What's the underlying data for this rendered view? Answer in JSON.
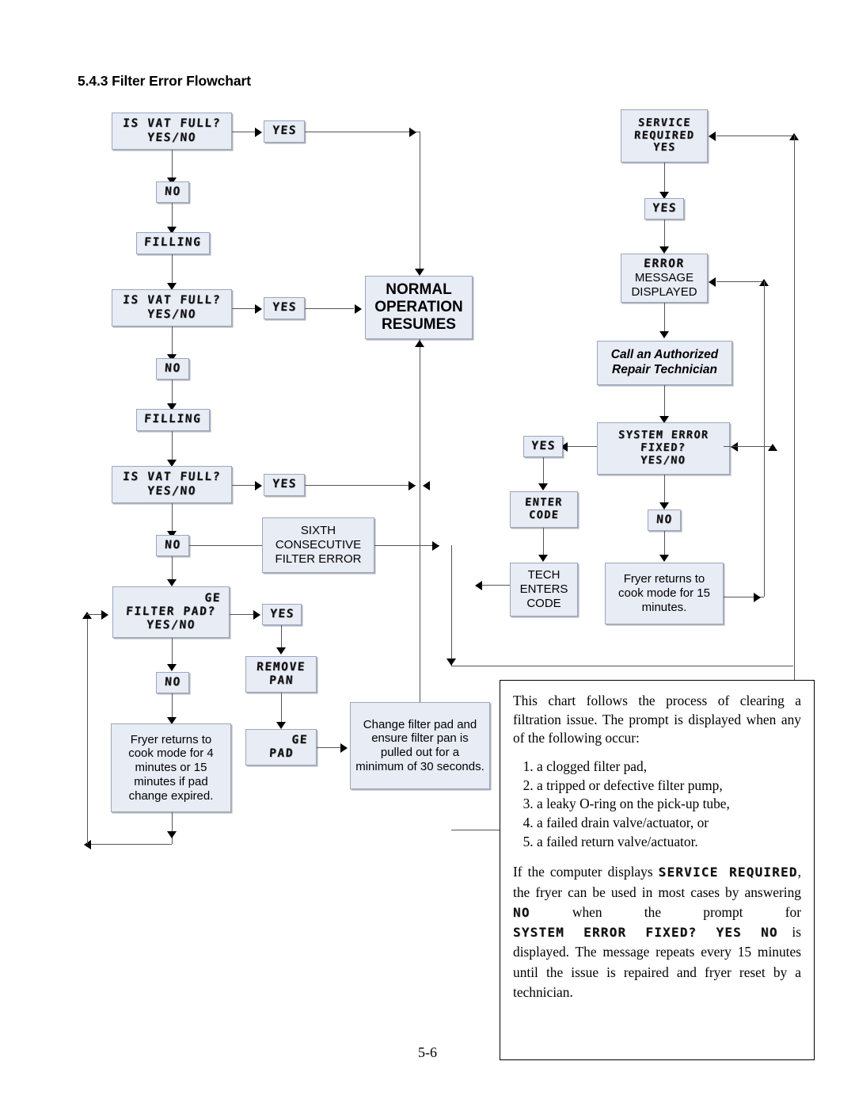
{
  "heading": "5.4.3 Filter Error Flowchart",
  "folio": "5-6",
  "left_column": {
    "vat_full_1": {
      "line1": "IS VAT FULL?",
      "line2": "YES/NO"
    },
    "yes_1": "YES",
    "no_1": "NO",
    "filling_1": "FILLING",
    "vat_full_2": {
      "line1": "IS VAT FULL?",
      "line2": "YES/NO"
    },
    "yes_2": "YES",
    "no_2": "NO",
    "filling_2": "FILLING",
    "vat_full_3": {
      "line1": "IS VAT FULL?",
      "line2": "YES/NO"
    },
    "yes_3": "YES",
    "no_3": "NO",
    "sixth_error": {
      "line1": "SIXTH",
      "line2": "CONSECUTIVE",
      "line3": "FILTER ERROR"
    },
    "change_pad_prompt": {
      "line1": "GE",
      "line2": "FILTER PAD?",
      "line3": "YES/NO"
    },
    "yes_4": "YES",
    "no_4": "NO",
    "remove_pan": {
      "line1": "REMOVE",
      "line2": "PAN"
    },
    "change_pad": {
      "line1": "GE",
      "line2": "PAD"
    },
    "fryer_returns_4": "Fryer returns to cook mode for 4 minutes or 15 minutes if pad change expired.",
    "change_filter_pad_note": "Change filter pad and ensure filter pan is pulled out for a minimum of 30 seconds."
  },
  "center": {
    "normal_operation": {
      "line1": "NORMAL",
      "line2": "OPERATION",
      "line3": "RESUMES"
    }
  },
  "right_column": {
    "service_required": {
      "line1": "SERVICE",
      "line2": "REQUIRED",
      "line3": "YES"
    },
    "yes_top": "YES",
    "error_message": {
      "lcd": "ERROR",
      "line2": "MESSAGE",
      "line3": "DISPLAYED"
    },
    "call_technician": {
      "line1": "Call an Authorized",
      "line2": "Repair Technician"
    },
    "system_error": {
      "line1": "SYSTEM ERROR",
      "line2": "FIXED?",
      "line3": "YES/NO"
    },
    "yes_sys": "YES",
    "no_sys": "NO",
    "enter_code": {
      "line1": "ENTER",
      "line2": "CODE"
    },
    "tech_enters_code": {
      "line1": "TECH",
      "line2": "ENTERS",
      "line3": "CODE"
    },
    "fryer_returns_15": "Fryer returns to cook mode for 15 minutes."
  },
  "note": {
    "intro": "This chart follows the process of clearing a filtration issue. The prompt is displayed when any of the following occur:",
    "causes": [
      "a clogged filter pad,",
      "a tripped or defective filter pump,",
      "a leaky O-ring on the pick-up tube,",
      "a failed drain valve/actuator, or",
      "a failed return valve/actuator."
    ],
    "para2": {
      "t1": "If the computer displays ",
      "lcd1": "SERVICE REQUIRED",
      "t2": ", the fryer can be used in most cases by answering ",
      "lcd2": "NO",
      "t3": " when the prompt for ",
      "lcd3": "SYSTEM ERROR FIXED? YES NO",
      "t4": " is displayed. The message repeats every 15 minutes until the issue is repaired and fryer reset by a technician."
    }
  },
  "colors": {
    "box_fill": "#e7ecf5",
    "box_border": "#9aa6c0",
    "line": "#555555",
    "text": "#000000"
  }
}
